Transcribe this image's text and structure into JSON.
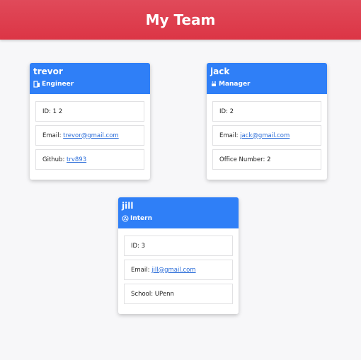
{
  "header": {
    "title": "My Team"
  },
  "employees": [
    {
      "name": "trevor",
      "role": "Engineer",
      "role_icon": "glasses-icon",
      "id_label": "ID:",
      "id": "1 2",
      "email_label": "Email:",
      "email": "trevor@gmail.com",
      "extra_label": "Github:",
      "extra_value": "trv893"
    },
    {
      "name": "jack",
      "role": "Manager",
      "role_icon": "mug-icon",
      "id_label": "ID:",
      "id": "2",
      "email_label": "Email:",
      "email": "jack@gmail.com",
      "extra_label": "Office Number:",
      "extra_value": "2"
    },
    {
      "name": "jill",
      "role": "Intern",
      "role_icon": "graduation-cap-icon",
      "id_label": "ID:",
      "id": "3",
      "email_label": "Email:",
      "email": "jill@gmail.com",
      "extra_label": "School:",
      "extra_value": "UPenn"
    }
  ],
  "colors": {
    "header_bg": "#dc3545",
    "card_header_bg": "#2f7ff7",
    "link": "#2b6dd9"
  }
}
